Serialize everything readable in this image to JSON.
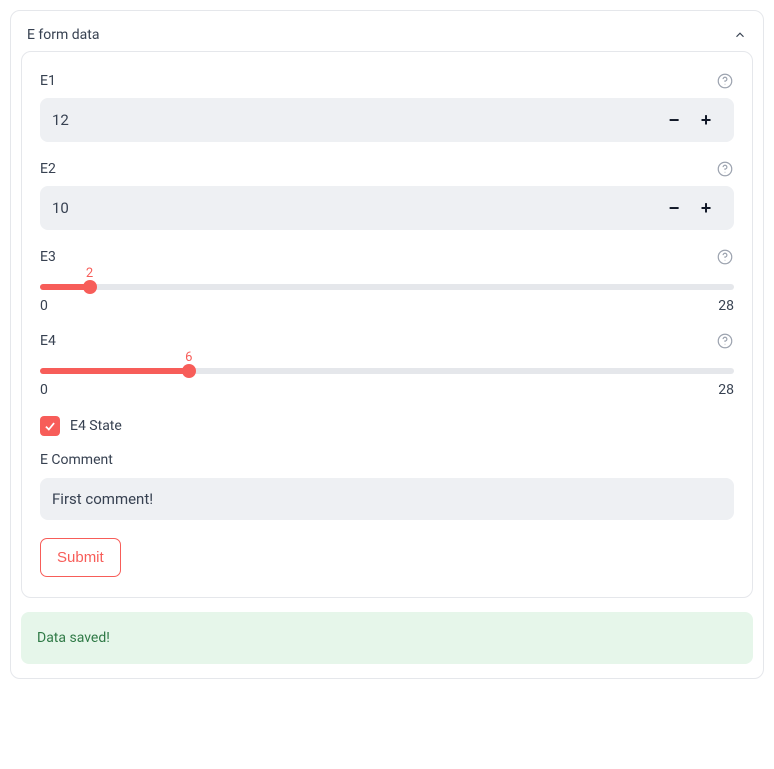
{
  "panel": {
    "title": "E form data"
  },
  "fields": {
    "e1": {
      "label": "E1",
      "value": "12"
    },
    "e2": {
      "label": "E2",
      "value": "10"
    },
    "e3": {
      "label": "E3",
      "value": "2",
      "min": "0",
      "max": "28"
    },
    "e4": {
      "label": "E4",
      "value": "6",
      "min": "0",
      "max": "28"
    },
    "e4state": {
      "label": "E4 State",
      "checked": true
    },
    "comment": {
      "label": "E Comment",
      "value": "First comment!"
    }
  },
  "buttons": {
    "submit": "Submit"
  },
  "alert": {
    "message": "Data saved!"
  }
}
